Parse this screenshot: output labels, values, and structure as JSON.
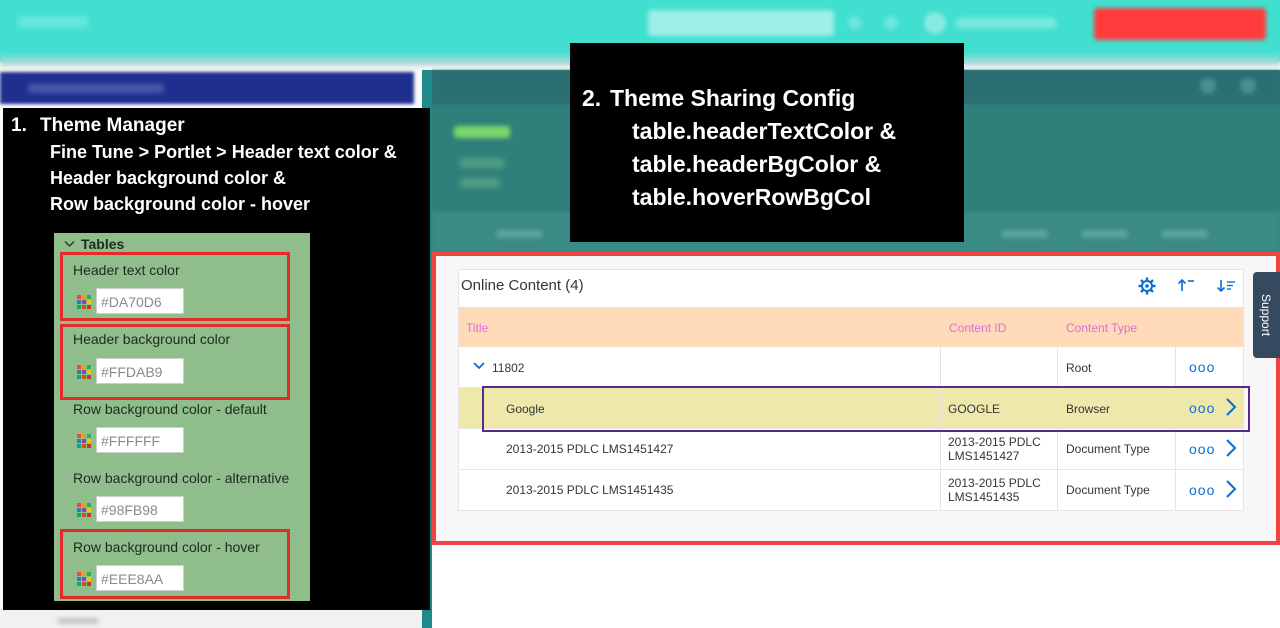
{
  "overlay_theme_manager": {
    "heading_num": "1.",
    "heading_text": "Theme Manager",
    "line1": "Fine Tune > Portlet > Header text color &",
    "line2": "Header background color &",
    "line3": "Row background color - hover",
    "card": {
      "title": "Tables",
      "fields": [
        {
          "label": "Header text color",
          "value": "#DA70D6"
        },
        {
          "label": "Header background color",
          "value": "#FFDAB9"
        },
        {
          "label": "Row background color - default",
          "value": "#FFFFFF"
        },
        {
          "label": "Row background color - alternative",
          "value": "#98FB98"
        },
        {
          "label": "Row background color - hover",
          "value": "#EEE8AA"
        }
      ]
    }
  },
  "overlay_theme_sharing": {
    "heading_num": "2.",
    "heading_text": "Theme Sharing Config",
    "line1": "table.headerTextColor &",
    "line2": "table.headerBgColor &",
    "line3": "table.hoverRowBgCol"
  },
  "online_content": {
    "title": "Online Content (4)",
    "icons": [
      "settings-gear-icon",
      "sort-ascending-icon",
      "sort-descending-icon"
    ],
    "columns": [
      "Title",
      "Content ID",
      "Content Type"
    ],
    "rows": [
      {
        "title": "11802",
        "content_id": "",
        "content_type": "Root",
        "expandable": true
      },
      {
        "title": "Google",
        "content_id": "GOOGLE",
        "content_type": "Browser",
        "hover": true
      },
      {
        "title": "2013-2015 PDLC LMS1451427",
        "content_id_line1": "2013-2015 PDLC",
        "content_id_line2": "LMS1451427",
        "content_type": "Document Type"
      },
      {
        "title": "2013-2015 PDLC LMS1451435",
        "content_id_line1": "2013-2015 PDLC",
        "content_id_line2": "LMS1451435",
        "content_type": "Document Type"
      }
    ],
    "more_glyph": "ooo"
  },
  "support_tab": {
    "label": "Support"
  },
  "colors": {
    "header_text": "#DA70D6",
    "header_bg": "#FFDAB9",
    "row_hover": "#EEE8AA",
    "highlight_red": "#E32B2B",
    "highlight_purple": "#5A2A88",
    "shell_teal": "#40DFD0"
  }
}
